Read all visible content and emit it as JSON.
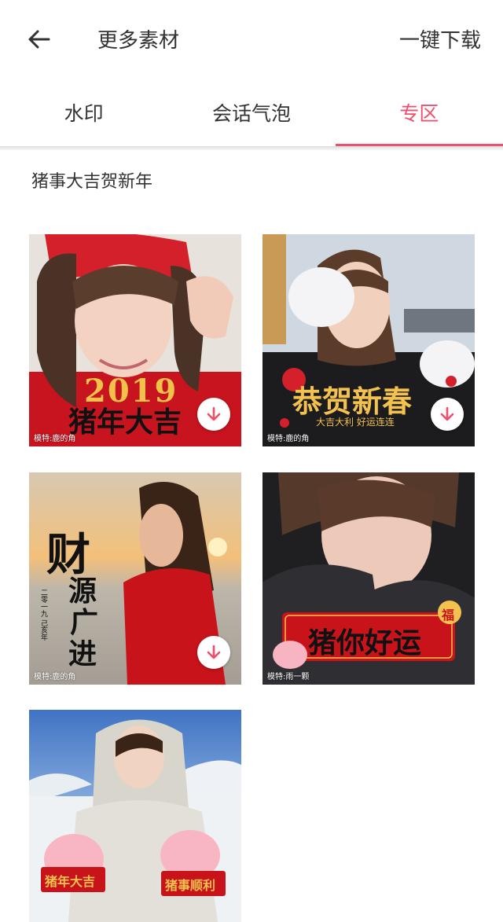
{
  "header": {
    "title": "更多素材",
    "download_all": "一键下载"
  },
  "tabs": [
    {
      "label": "水印",
      "active": false
    },
    {
      "label": "会话气泡",
      "active": false
    },
    {
      "label": "专区",
      "active": true
    }
  ],
  "section": {
    "title": "猪事大吉贺新年"
  },
  "colors": {
    "accent": "#ef4f6c",
    "text": "#333333"
  },
  "cards": [
    {
      "overlay_year": "2019",
      "overlay": "猪年大吉",
      "model": "模特:鹿的角",
      "has_download": true
    },
    {
      "overlay": "恭贺新春",
      "overlay_sub": "大吉大利  好运连连",
      "model": "模特:鹿的角",
      "has_download": true
    },
    {
      "overlay": "财源广进",
      "overlay_sub": "二零一九 己亥年",
      "model": "模特:鹿的角",
      "has_download": true
    },
    {
      "overlay": "猪你好运",
      "overlay_badge": "福",
      "model": "模特:雨一颗",
      "has_download": false
    },
    {
      "overlay_left": "猪年大吉",
      "overlay_right": "猪事顺利",
      "has_download": false
    }
  ]
}
